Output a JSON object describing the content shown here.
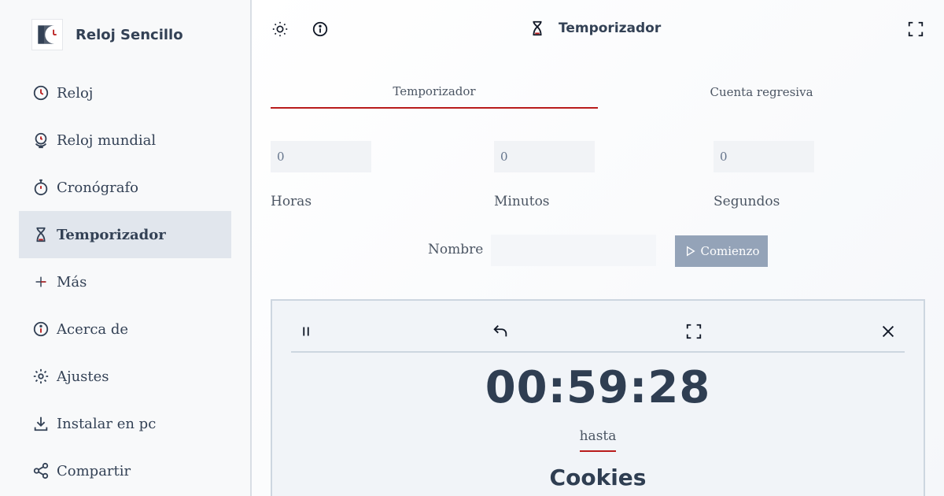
{
  "app": {
    "name": "Reloj Sencillo",
    "logo_icon": "clock-logo-icon"
  },
  "sidebar": {
    "items": [
      {
        "label": "Reloj",
        "icon": "clock-icon",
        "active": false
      },
      {
        "label": "Reloj mundial",
        "icon": "globe-clock-icon",
        "active": false
      },
      {
        "label": "Cronógrafo",
        "icon": "stopwatch-icon",
        "active": false
      },
      {
        "label": "Temporizador",
        "icon": "hourglass-icon",
        "active": true
      },
      {
        "label": "Más",
        "icon": "plus-icon",
        "active": false
      },
      {
        "label": "Acerca de",
        "icon": "info-icon",
        "active": false
      },
      {
        "label": "Ajustes",
        "icon": "gear-icon",
        "active": false
      },
      {
        "label": "Instalar en pc",
        "icon": "download-icon",
        "active": false
      },
      {
        "label": "Compartir",
        "icon": "share-icon",
        "active": false
      }
    ]
  },
  "header": {
    "title": "Temporizador",
    "title_icon": "hourglass-icon",
    "left_buttons": [
      "brightness-icon",
      "info-icon"
    ],
    "right_button": "fullscreen-icon"
  },
  "tabs": [
    {
      "label": "Temporizador",
      "active": true
    },
    {
      "label": "Cuenta regresiva",
      "active": false
    }
  ],
  "form": {
    "hours": {
      "value": "0",
      "label": "Horas"
    },
    "minutes": {
      "value": "0",
      "label": "Minutos"
    },
    "seconds": {
      "value": "0",
      "label": "Segundos"
    },
    "name_label": "Nombre",
    "name_value": "",
    "start_label": "Comienzo"
  },
  "running_timer": {
    "time": "00:59:28",
    "until_label": "hasta",
    "name": "Cookies",
    "controls": [
      "pause-icon",
      "reset-icon",
      "fullscreen-icon",
      "close-icon"
    ]
  },
  "colors": {
    "accent": "#b91c1c",
    "sidebar_bg": "#f8f9fa",
    "active_nav_bg": "#e1e6ed",
    "text": "#334155",
    "button_disabled": "#94a3b8"
  }
}
